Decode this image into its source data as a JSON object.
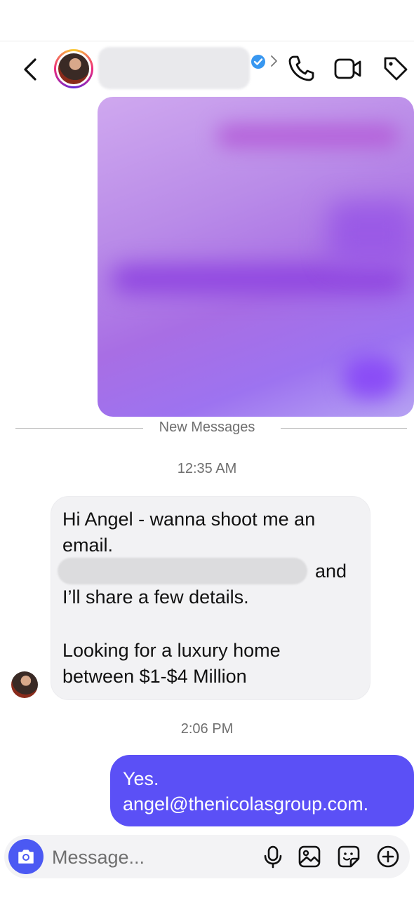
{
  "divider": {
    "label": "New Messages"
  },
  "timestamps": [
    "12:35 AM",
    "2:06 PM"
  ],
  "incoming_message": {
    "lines": [
      "Hi Angel - wanna shoot me an",
      "email.",
      "and",
      "I’ll share a few details.",
      "Looking for a luxury home",
      "between $1-$4 Million"
    ]
  },
  "outgoing_message": {
    "lines": [
      "Yes.",
      "angel@thenicolasgroup.com."
    ],
    "color": "#5b50f6"
  },
  "composer": {
    "placeholder": "Message..."
  },
  "colors": {
    "accent": "#4b59f3",
    "verified": "#3897f0"
  }
}
